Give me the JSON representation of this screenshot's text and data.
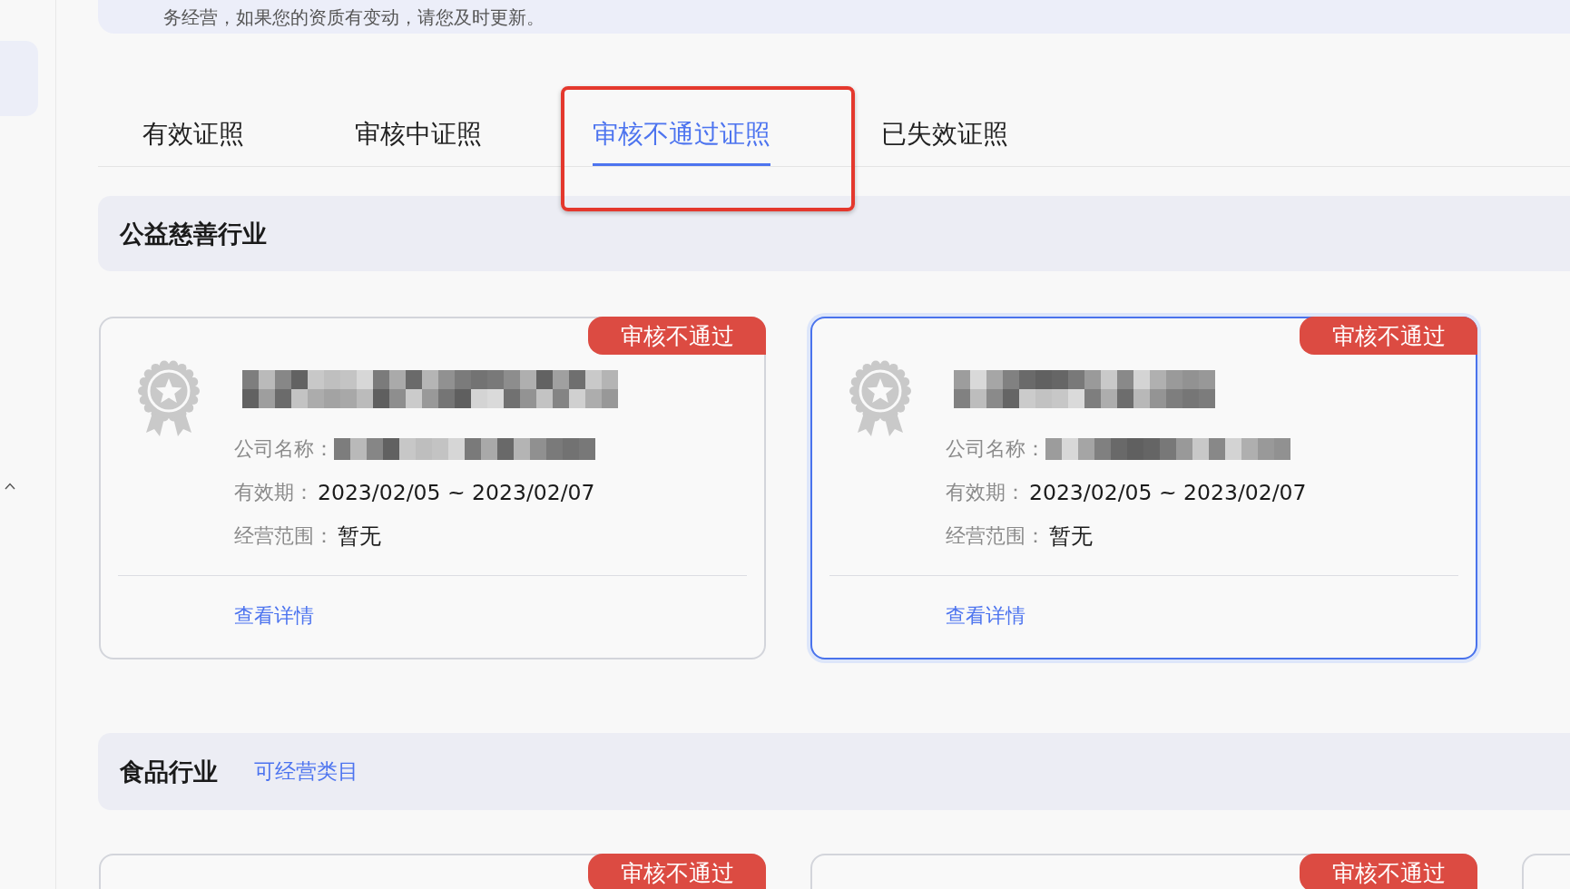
{
  "notice": {
    "text": "务经营，如果您的资质有变动，请您及时更新。"
  },
  "sidebar": {
    "items": [
      {
        "kind": "block",
        "selected": true
      },
      {
        "kind": "toggle",
        "expanded": true
      }
    ]
  },
  "tabs": [
    {
      "label": "有效证照",
      "selected": false,
      "annotated": false
    },
    {
      "label": "审核中证照",
      "selected": false,
      "annotated": false
    },
    {
      "label": "审核不通过证照",
      "selected": true,
      "annotated": true
    },
    {
      "label": "已失效证照",
      "selected": false,
      "annotated": false
    }
  ],
  "sections": [
    {
      "title": "公益慈善行业",
      "cards": [
        {
          "selected": false,
          "badge": "审核不通过",
          "title": {
            "kind": "redacted"
          },
          "fields": [
            {
              "kind": "redacted",
              "label": "公司名称："
            },
            {
              "kind": "text",
              "label": "有效期：",
              "value": "2023/02/05 ~ 2023/02/07"
            },
            {
              "kind": "text",
              "label": "经营范围：",
              "value": "暂无"
            }
          ],
          "link": "查看详情"
        },
        {
          "selected": true,
          "badge": "审核不通过",
          "title": {
            "kind": "redacted"
          },
          "fields": [
            {
              "kind": "redacted",
              "label": "公司名称："
            },
            {
              "kind": "text",
              "label": "有效期：",
              "value": "2023/02/05 ~ 2023/02/07"
            },
            {
              "kind": "text",
              "label": "经营范围：",
              "value": "暂无"
            }
          ],
          "link": "查看详情"
        }
      ]
    },
    {
      "title": "食品行业",
      "link": "可经营类目",
      "cards": [
        {
          "selected": false,
          "badge": "审核不通过"
        },
        {
          "selected": false,
          "badge": "审核不通过"
        },
        {
          "selected": false
        }
      ]
    }
  ]
}
